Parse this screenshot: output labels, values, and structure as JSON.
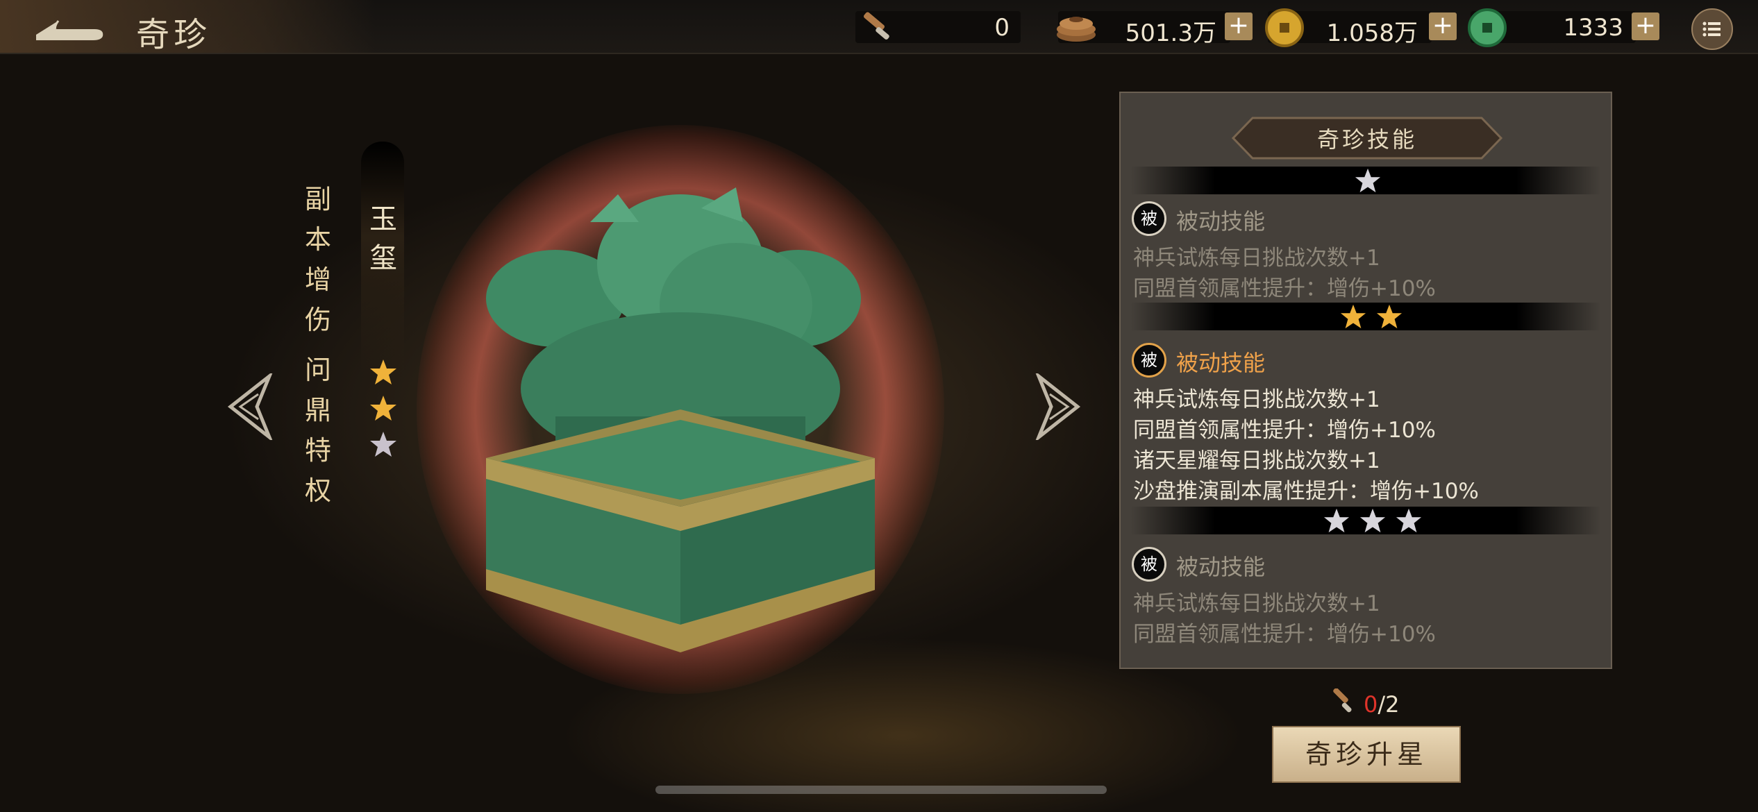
{
  "header": {
    "title": "奇珍",
    "back_icon": "back-arrow-icon"
  },
  "resources": [
    {
      "icon": "token-scroll-icon",
      "value": "0"
    },
    {
      "icon": "copper-coins-icon",
      "value": "501.3万"
    },
    {
      "icon": "gold-coin-icon",
      "value": "1.058万"
    },
    {
      "icon": "jade-coin-icon",
      "value": "1333"
    }
  ],
  "treasure": {
    "name": "玉玺",
    "effect_col1": "副本增伤",
    "effect_col2": "问鼎特权",
    "stars_total": 3,
    "stars_filled": 2,
    "image": "jade-imperial-seal-with-dragons"
  },
  "panel": {
    "title": "奇珍技能",
    "skills": [
      {
        "stars": 1,
        "badge": "被",
        "name": "被动技能",
        "active": false,
        "lines": [
          "神兵试炼每日挑战次数+1",
          "同盟首领属性提升：增伤+10%"
        ]
      },
      {
        "stars": 2,
        "badge": "被",
        "name": "被动技能",
        "active": true,
        "lines": [
          "神兵试炼每日挑战次数+1",
          "同盟首领属性提升：增伤+10%",
          "诸天星耀每日挑战次数+1",
          "沙盘推演副本属性提升：增伤+10%"
        ]
      },
      {
        "stars": 3,
        "badge": "被",
        "name": "被动技能",
        "active": false,
        "lines": [
          "神兵试炼每日挑战次数+1",
          "同盟首领属性提升：增伤+10%"
        ]
      }
    ]
  },
  "upgrade": {
    "cost_have": "0",
    "cost_sep": "/",
    "cost_need": "2",
    "button_label": "奇珍升星"
  },
  "colors": {
    "accent_gold": "#f0b23a",
    "active_skill": "#f0a24a",
    "cost_red": "#e0342a",
    "panel_bg": "#45403a"
  }
}
